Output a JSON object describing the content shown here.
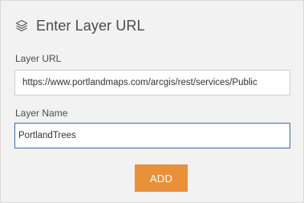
{
  "header": {
    "icon": "layers-icon",
    "title": "Enter Layer URL"
  },
  "form": {
    "url_label": "Layer URL",
    "url_value": "https://www.portlandmaps.com/arcgis/rest/services/Public",
    "name_label": "Layer Name",
    "name_value": "PortlandTrees"
  },
  "actions": {
    "add_label": "ADD"
  },
  "colors": {
    "accent": "#e8903a",
    "focus_border": "#3b6ba5",
    "panel_bg": "#f2f2f2"
  }
}
